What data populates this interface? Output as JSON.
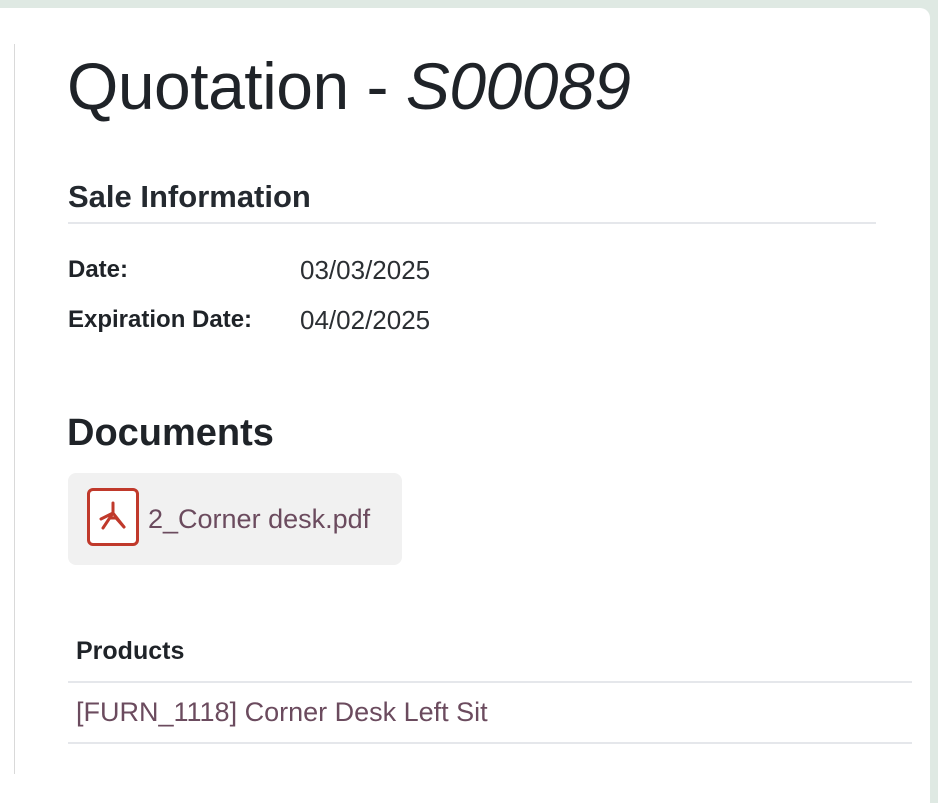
{
  "quotation": {
    "title_prefix": "Quotation - ",
    "reference": "S00089"
  },
  "sale_information": {
    "heading": "Sale Information",
    "fields": [
      {
        "label": "Date:",
        "value": "03/03/2025"
      },
      {
        "label": "Expiration Date:",
        "value": "04/02/2025"
      }
    ]
  },
  "documents": {
    "heading": "Documents",
    "items": [
      {
        "name": "2_Corner desk.pdf",
        "icon": "pdf-file-icon"
      }
    ]
  },
  "products": {
    "header": "Products",
    "rows": [
      {
        "name": "[FURN_1118] Corner Desk Left Sit"
      }
    ]
  },
  "colors": {
    "background": "#dfe9e3",
    "pdf_accent": "#c0392b",
    "link_text": "#6b4b5e"
  }
}
